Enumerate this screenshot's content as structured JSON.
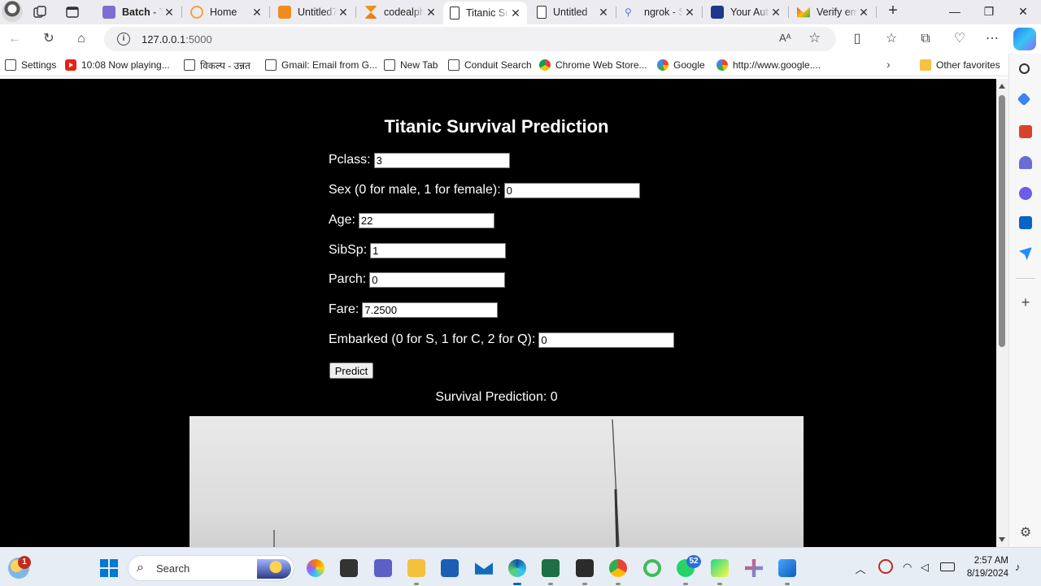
{
  "browser": {
    "tabs": [
      {
        "title": "Batch - T",
        "active": false
      },
      {
        "title": "Home",
        "active": false
      },
      {
        "title": "Untitled7",
        "active": false
      },
      {
        "title": "codealph",
        "active": false
      },
      {
        "title": "Titanic Su",
        "active": true
      },
      {
        "title": "Untitled",
        "active": false
      },
      {
        "title": "ngrok - S",
        "active": false
      },
      {
        "title": "Your Auth",
        "active": false
      },
      {
        "title": "Verify em",
        "active": false
      }
    ],
    "url": {
      "host": "127.0.0.1",
      "port": ":5000"
    },
    "read_aloud": "Aᴬ",
    "favorites": [
      {
        "label": "Settings",
        "icon": "page-icon"
      },
      {
        "label": "10:08 Now playing...",
        "icon": "youtube-icon"
      },
      {
        "label": "विकल्प - उन्नत",
        "icon": "page-icon"
      },
      {
        "label": "Gmail: Email from G...",
        "icon": "page-icon"
      },
      {
        "label": "New Tab",
        "icon": "page-icon"
      },
      {
        "label": "Conduit Search",
        "icon": "page-icon"
      },
      {
        "label": "Chrome Web Store...",
        "icon": "chrome-web-store-icon"
      },
      {
        "label": "Google",
        "icon": "google-icon"
      },
      {
        "label": "http://www.google....",
        "icon": "google-icon"
      }
    ],
    "other_favorites": "Other favorites"
  },
  "page": {
    "title": "Titanic Survival Prediction",
    "fields": [
      {
        "label": "Pclass:",
        "value": "3"
      },
      {
        "label": "Sex (0 for male, 1 for female):",
        "value": "0"
      },
      {
        "label": "Age:",
        "value": "22"
      },
      {
        "label": "SibSp:",
        "value": "1"
      },
      {
        "label": "Parch:",
        "value": "0"
      },
      {
        "label": "Fare:",
        "value": "7.2500"
      },
      {
        "label": "Embarked (0 for S, 1 for C, 2 for Q):",
        "value": "0"
      }
    ],
    "predict_label": "Predict",
    "result": "Survival Prediction: 0"
  },
  "taskbar": {
    "search_label": "Search",
    "weather_badge": "1",
    "whatsapp_badge": "52",
    "time": "2:57 AM",
    "date": "8/19/2024"
  },
  "colors": {
    "page_bg": "#000000",
    "accent": "#0067c0",
    "tab_bar": "#ececf0"
  }
}
